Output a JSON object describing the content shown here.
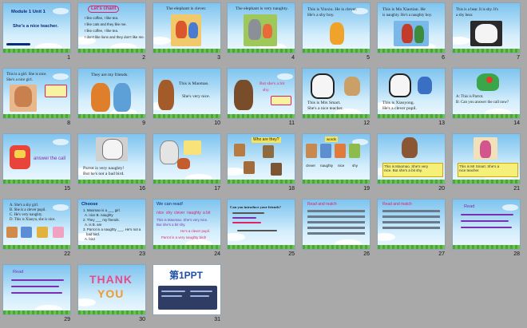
{
  "numbers": [
    "1",
    "2",
    "3",
    "4",
    "5",
    "6",
    "7",
    "8",
    "9",
    "10",
    "11",
    "12",
    "13",
    "14",
    "15",
    "16",
    "17",
    "18",
    "19",
    "20",
    "21",
    "22",
    "23",
    "24",
    "25",
    "26",
    "27",
    "28",
    "29",
    "30",
    "31"
  ],
  "s1": {
    "title": "Module 1 Unit 1",
    "subtitle": "She's a nice teacher."
  },
  "s2": {
    "heading": "Let's chant",
    "lines": [
      "I like coffee, I like tea.",
      "I like cats and they like me.",
      "I like coffee, I like tea.",
      "I don't like lions and they don't like me."
    ]
  },
  "s3": {
    "caption": "The elephant is clever."
  },
  "s4": {
    "caption": "The elephant is very naughty."
  },
  "s5": {
    "line1": "This is Yinxiu. He is clever.",
    "line2": "He's a shy boy."
  },
  "s6": {
    "line1": "This is Ma Xiaotian. He",
    "line2": "is naughty. He's a naughty boy."
  },
  "s7": {
    "line1": "This is a bear. It is shy. It's",
    "line2": "a shy bear."
  },
  "s8": {
    "line1": "This is a girl. She is nice.",
    "line2": "She's a nice girl."
  },
  "s9": {
    "caption": "They are my friends."
  },
  "s10": {
    "line1": "This is Maomao.",
    "line2": "She's very nice."
  },
  "s11": {
    "line1": "But she's a bit",
    "line2": "shy."
  },
  "s12": {
    "line1": "This is Mrs Smart.",
    "line2": "She's a nice teacher."
  },
  "s13": {
    "line1": "This is Xiaoyong.",
    "line2": "He's a clever pupil."
  },
  "s14": {
    "line1": "A: This is Parrot.",
    "line2": "B: Can you answer the call now?"
  },
  "s15": {
    "caption": "answer the call"
  },
  "s16": {
    "line1": "Parrot is very naughty!",
    "line2": "But he's not a bad bird."
  },
  "s18": {
    "heading": "Who are they?"
  },
  "s19": {
    "heading": "words",
    "words": [
      "clever",
      "naughty",
      "nice",
      "shy"
    ]
  },
  "s20": {
    "line1": "This is Maomao. She's very",
    "line2": "nice. But she's a bit shy."
  },
  "s21": {
    "line1": "This is Mr Smart. She's a",
    "line2": "nice teacher."
  },
  "s22": {
    "lines": [
      "A. She's a shy girl.",
      "B. She is a clever pupil.",
      "C. He's very naughty.",
      "D. This is Xiaoyu, she is nice."
    ]
  },
  "s23": {
    "heading": "Choose",
    "lines": [
      "1. Maomao is a ___ girl.",
      "A. nice   B. naughty",
      "2. They ___ my friends.",
      "A. is   B. are",
      "3. Parrot is a naughty ___. He's not a",
      "bad bird.",
      "A. bird"
    ]
  },
  "s24": {
    "heading": "We can read!",
    "words": [
      "nice",
      "shy",
      "clever",
      "naughty",
      "a bit"
    ],
    "lines": [
      "This is Maomao. She's very nice.",
      "But she's a bit shy.",
      "He's a clever pupil.",
      "Parrot is a very naughty bird!"
    ]
  },
  "s25": {
    "heading": "Can you introduce your friends?"
  },
  "s26": {
    "heading": "Read and match"
  },
  "s28": {
    "heading": "Read"
  },
  "s29": {
    "heading": "Read"
  },
  "s30": {
    "thank": "THANK",
    "you": "YOU"
  },
  "s31": {
    "brand": "第1PPT"
  }
}
